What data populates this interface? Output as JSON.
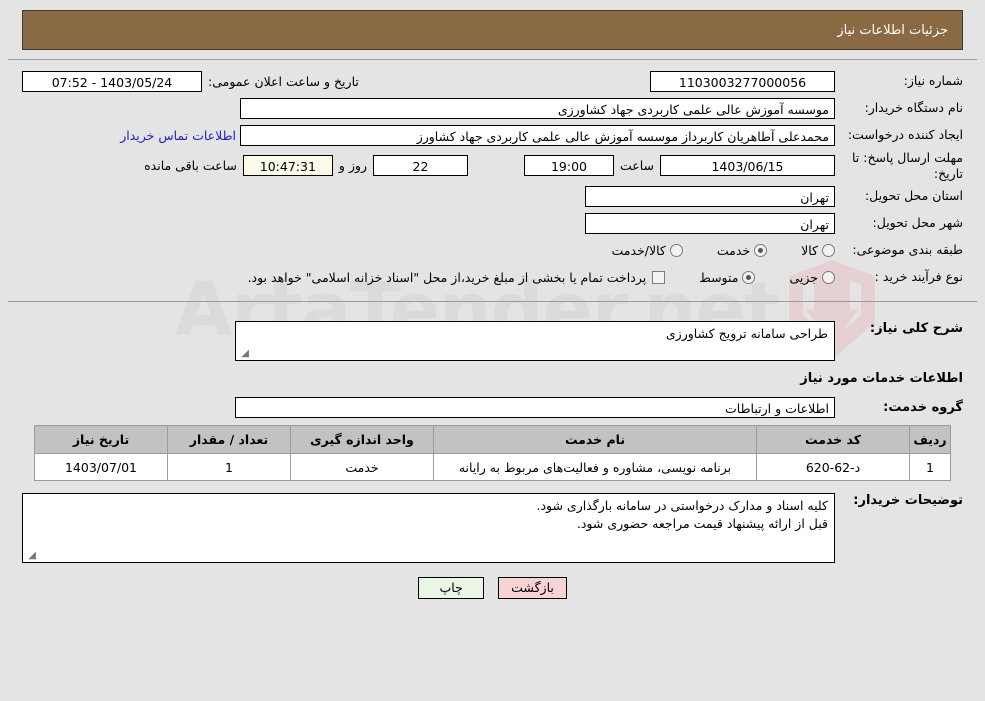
{
  "header": {
    "title": "جزئیات اطلاعات نیاز"
  },
  "watermark": {
    "text": "ArtaTender.net",
    "shield_color": "#e8a8ad",
    "text_color": "#c9c9c9"
  },
  "form": {
    "need_number_label": "شماره نیاز:",
    "need_number_value": "1103003277000056",
    "publish_label": "تاریخ و ساعت اعلان عمومی:",
    "publish_value": "1403/05/24 - 07:52",
    "buyer_org_label": "نام دستگاه خریدار:",
    "buyer_org_value": "موسسه آموزش عالی علمی کاربردی جهاد کشاورزی",
    "creator_label": "ایجاد کننده درخواست:",
    "creator_value": "محمدعلی آطاهریان کاربرداز موسسه آموزش عالی علمی کاربردی جهاد کشاورز",
    "contact_link": "اطلاعات تماس خریدار",
    "deadline_label": "مهلت ارسال پاسخ: تا تاریخ:",
    "deadline_date": "1403/06/15",
    "hour_label": "ساعت",
    "deadline_time": "19:00",
    "days_value": "22",
    "days_label": "روز و",
    "countdown_value": "10:47:31",
    "countdown_label": "ساعت باقی مانده",
    "province_label": "استان محل تحویل:",
    "province_value": "تهران",
    "city_label": "شهر محل تحویل:",
    "city_value": "تهران",
    "category_label": "طبقه بندی موضوعی:",
    "category_options": [
      {
        "label": "کالا",
        "selected": false
      },
      {
        "label": "خدمت",
        "selected": true
      },
      {
        "label": "کالا/خدمت",
        "selected": false
      }
    ],
    "process_label": "نوع فرآیند خرید :",
    "process_options": [
      {
        "label": "جزیی",
        "selected": false
      },
      {
        "label": "متوسط",
        "selected": true
      }
    ],
    "treasury_checked": false,
    "treasury_note": "پرداخت تمام یا بخشی از مبلغ خرید،از محل \"اسناد خزانه اسلامی\" خواهد بود."
  },
  "section2": {
    "summary_label": "شرح کلی نیاز:",
    "summary_value": "طراحی سامانه ترویج کشاورزی",
    "services_heading": "اطلاعات خدمات مورد نیاز",
    "group_label": "گروه خدمت:",
    "group_value": "اطلاعات و ارتباطات"
  },
  "table": {
    "headers": {
      "row": "ردیف",
      "code": "کد خدمت",
      "name": "نام خدمت",
      "unit": "واحد اندازه گیری",
      "qty": "تعداد / مقدار",
      "date": "تاریخ نیاز"
    },
    "rows": [
      {
        "row": "1",
        "code": "د-62-620",
        "name": "برنامه نویسی، مشاوره و فعالیت‌های مربوط به رایانه",
        "unit": "خدمت",
        "qty": "1",
        "date": "1403/07/01"
      }
    ]
  },
  "notes": {
    "label": "توضیحات خریدار:",
    "line1": "کلیه اسناد و مدارک درخواستی در سامانه بارگذاری شود.",
    "line2": "قبل از ارائه پیشنهاد قیمت مراجعه حضوری شود."
  },
  "footer": {
    "print_label": "چاپ",
    "back_label": "بازگشت"
  }
}
